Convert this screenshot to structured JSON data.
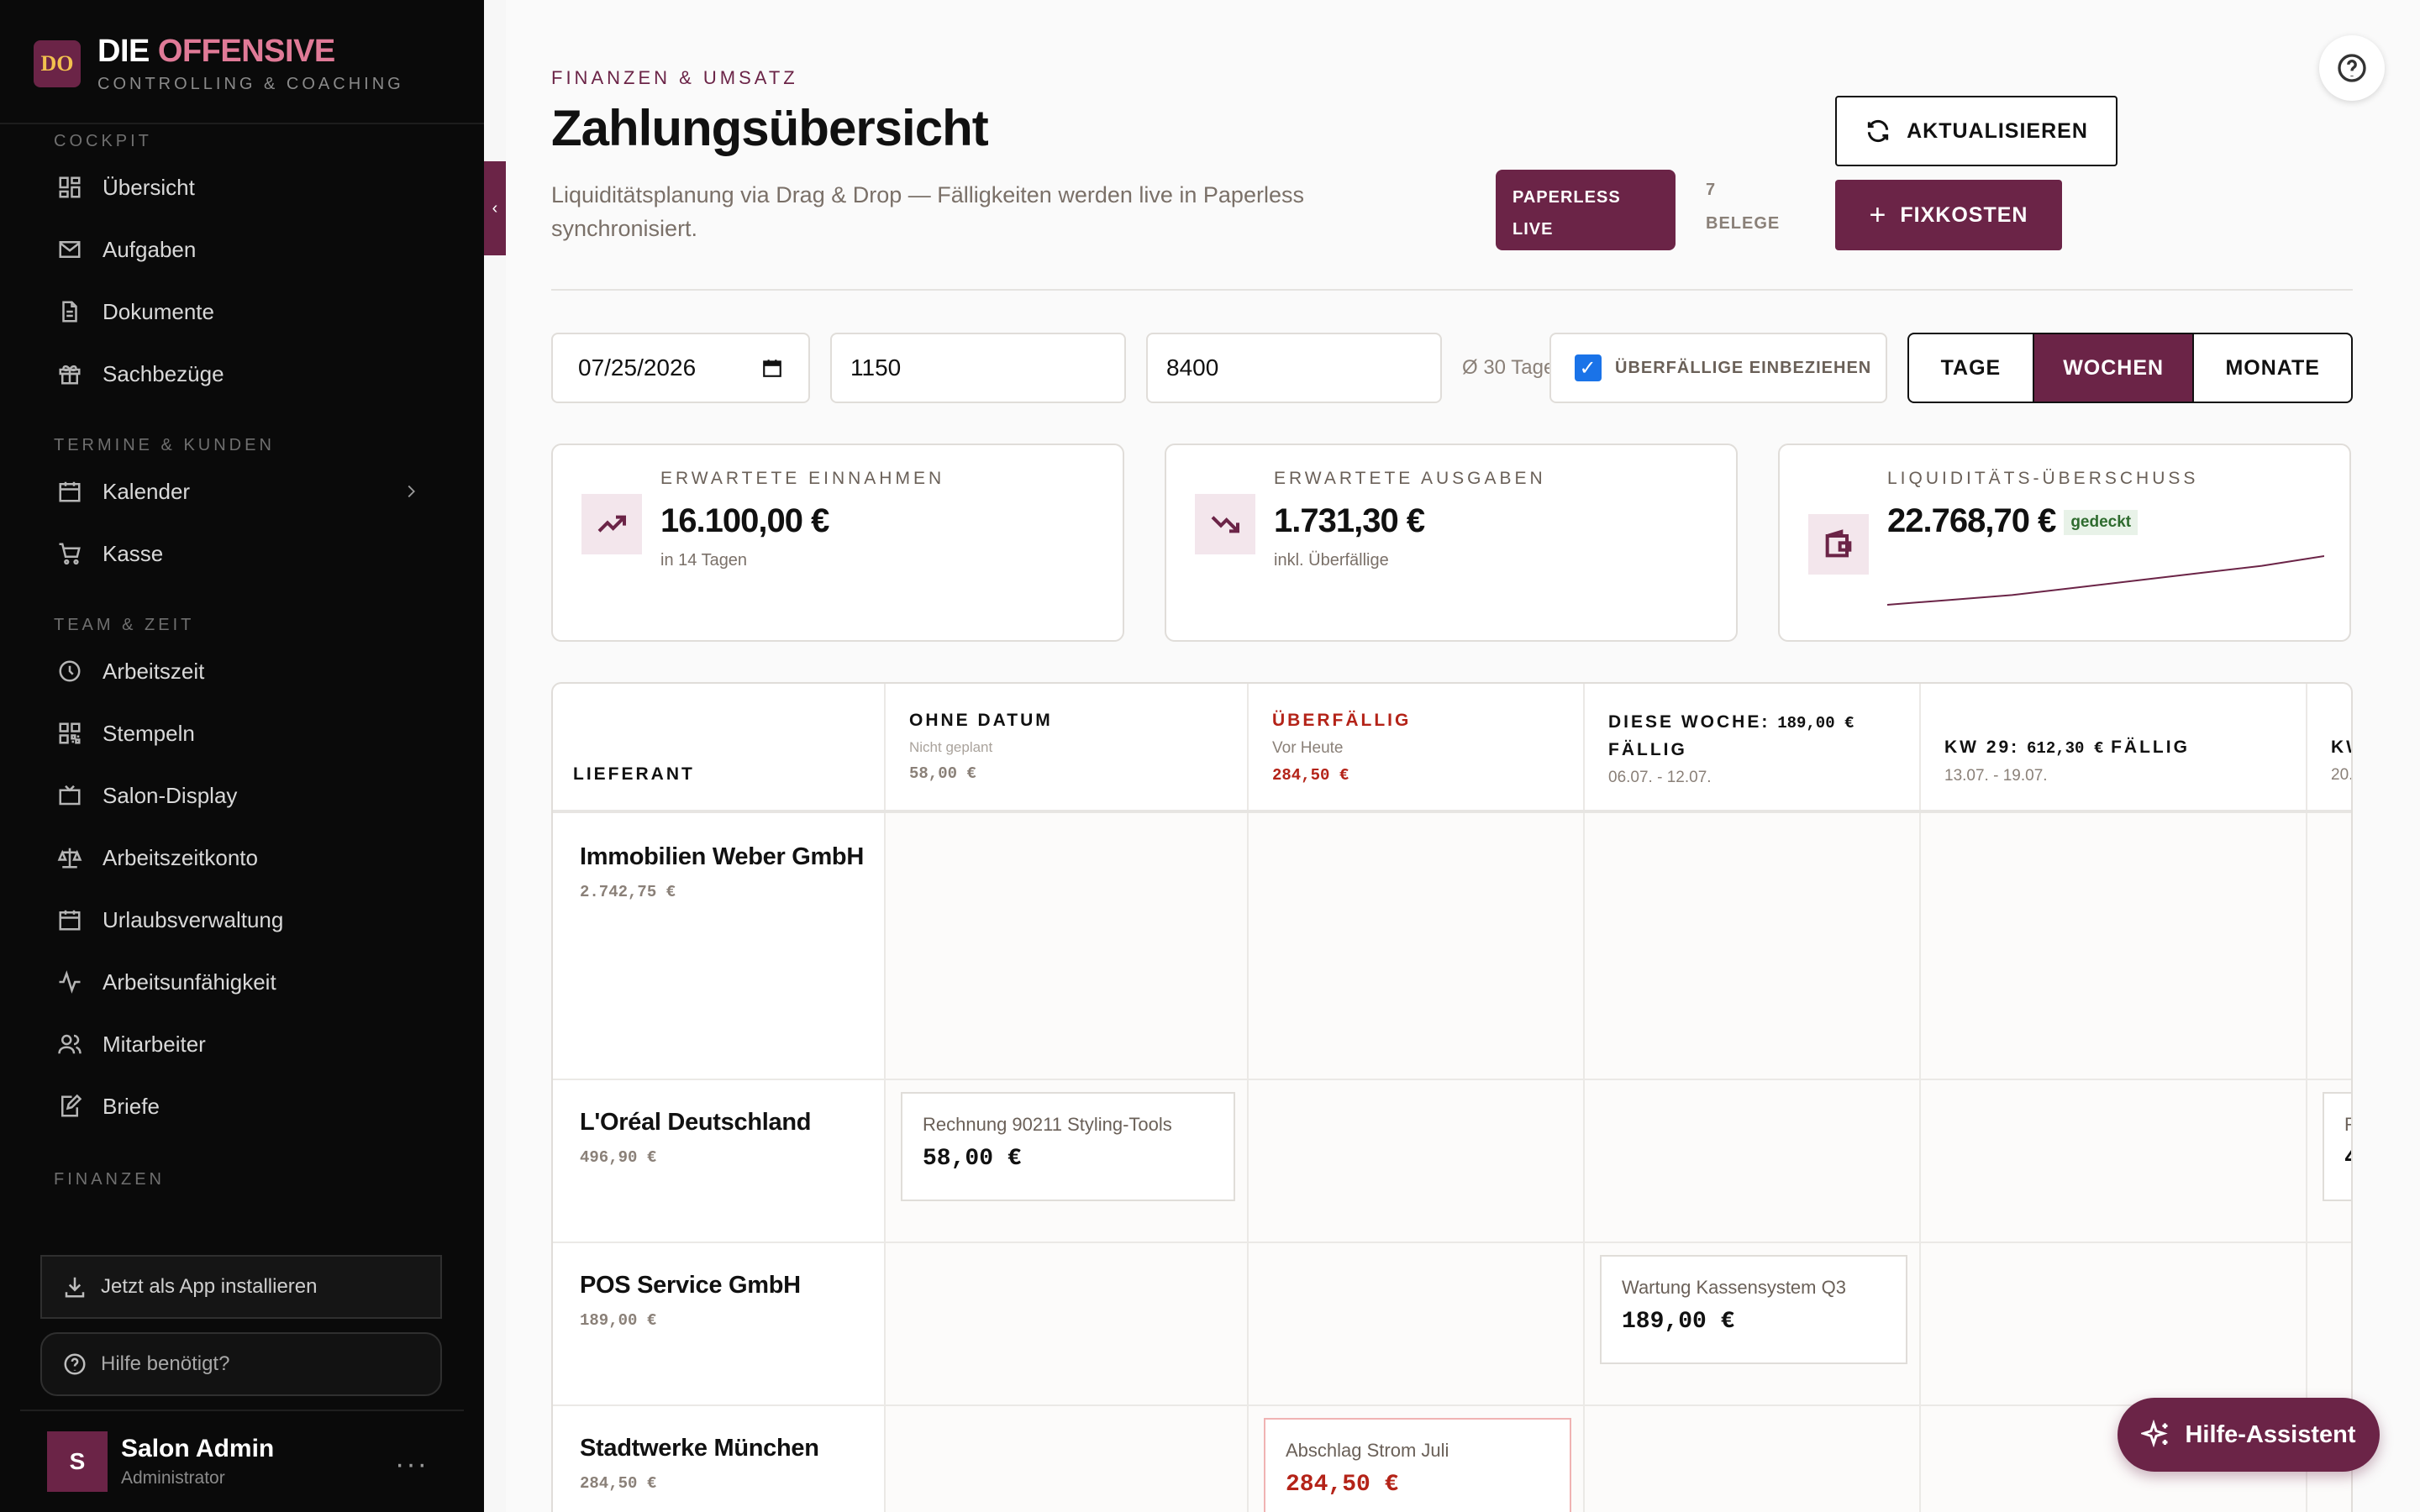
{
  "brand": {
    "logo": "DO",
    "title_main": "DIE ",
    "title_accent": "OFFENSIVE",
    "subtitle": "CONTROLLING & COACHING"
  },
  "sidebar": {
    "sections": [
      {
        "label": "COCKPIT",
        "items": [
          {
            "label": "Übersicht",
            "icon": "dashboard-icon"
          },
          {
            "label": "Aufgaben",
            "icon": "mail-icon"
          },
          {
            "label": "Dokumente",
            "icon": "document-icon"
          },
          {
            "label": "Sachbezüge",
            "icon": "gift-icon"
          }
        ]
      },
      {
        "label": "TERMINE & KUNDEN",
        "items": [
          {
            "label": "Kalender",
            "icon": "calendar-icon"
          },
          {
            "label": "Kasse",
            "icon": "cart-icon"
          }
        ]
      },
      {
        "label": "TEAM & ZEIT",
        "items": [
          {
            "label": "Arbeitszeit",
            "icon": "clock-icon"
          },
          {
            "label": "Stempeln",
            "icon": "qr-icon"
          },
          {
            "label": "Salon-Display",
            "icon": "tv-icon"
          },
          {
            "label": "Arbeitszeitkonto",
            "icon": "scale-icon"
          },
          {
            "label": "Urlaubsverwaltung",
            "icon": "calendar-icon"
          },
          {
            "label": "Arbeitsunfähigkeit",
            "icon": "activity-icon"
          },
          {
            "label": "Mitarbeiter",
            "icon": "users-icon"
          },
          {
            "label": "Briefe",
            "icon": "edit-icon"
          }
        ]
      },
      {
        "label": "FINANZEN",
        "items": []
      }
    ],
    "install_label": "Jetzt als App installieren",
    "help_label": "Hilfe benötigt?",
    "user": {
      "initial": "S",
      "name": "Salon Admin",
      "role": "Administrator",
      "more": "···"
    }
  },
  "header": {
    "eyebrow": "FINANZEN & UMSATZ",
    "title": "Zahlungsübersicht",
    "subtitle": "Liquiditätsplanung via Drag & Drop — Fälligkeiten werden live in Paperless synchronisiert.",
    "live_pill": [
      "PAPERLESS",
      "LIVE"
    ],
    "belege": [
      "7",
      "BELEGE"
    ],
    "refresh_label": "AKTUALISIEREN",
    "fixkosten_label": "FIXKOSTEN",
    "fixkosten_plus": "+"
  },
  "controls": {
    "date": "07/25/2026",
    "value1": "1150",
    "value2": "8400",
    "avg": "Ø 30 Tage",
    "overdue_label": "ÜBERFÄLLIGE EINBEZIEHEN",
    "overdue_checked": true,
    "views": [
      "TAGE",
      "WOCHEN",
      "MONATE"
    ],
    "active_view": "WOCHEN"
  },
  "kpis": [
    {
      "label": "ERWARTETE EINNAHMEN",
      "value": "16.100,00 €",
      "sub": "in 14 Tagen",
      "icon": "trending-up-icon"
    },
    {
      "label": "ERWARTETE AUSGABEN",
      "value": "1.731,30 €",
      "sub": "inkl. Überfällige",
      "icon": "trending-down-icon"
    },
    {
      "label": "LIQUIDITÄTS-ÜBERSCHUSS",
      "value": "22.768,70 €",
      "badge": "gedeckt",
      "icon": "wallet-icon",
      "trend": [
        0.0,
        0.1,
        0.2,
        0.35,
        0.5,
        0.65,
        0.8,
        1.0
      ]
    }
  ],
  "table": {
    "supplier_header": "LIEFERANT",
    "columns": [
      {
        "title": "OHNE DATUM",
        "sub": "Nicht geplant",
        "amount": "58,00 €"
      },
      {
        "title": "ÜBERFÄLLIG",
        "sub": "Vor Heute",
        "amount": "284,50 €"
      },
      {
        "title": "DIESE WOCHE:",
        "title_amount": "189,00 €",
        "title_suffix": "FÄLLIG",
        "sub": "06.07. - 12.07."
      },
      {
        "title": "KW 29:",
        "title_amount": "612,30 €",
        "title_suffix": "FÄLLIG",
        "sub": "13.07. - 19.07."
      },
      {
        "title": "KW",
        "sub": "20."
      }
    ],
    "rows": [
      {
        "name": "Immobilien Weber GmbH",
        "amount": "2.742,75 €"
      },
      {
        "name": "L'Oréal Deutschland",
        "amount": "496,90 €"
      },
      {
        "name": "POS Service GmbH",
        "amount": "189,00 €"
      },
      {
        "name": "Stadtwerke München",
        "amount": "284,50 €"
      }
    ],
    "invoices": [
      {
        "desc": "Rechnung 90211 Styling-Tools",
        "value": "58,00 €"
      },
      {
        "desc": "Wartung Kassensystem Q3",
        "value": "189,00 €"
      },
      {
        "desc": "Abschlag Strom Juli",
        "value": "284,50 €"
      },
      {
        "desc": "R",
        "value": "4"
      }
    ]
  },
  "assistant_label": "Hilfe-Assistent",
  "colors": {
    "brand": "#6b2447",
    "accent_pink": "#e07a97",
    "overdue": "#b42318",
    "sidebar_bg": "#0a0a0a"
  }
}
